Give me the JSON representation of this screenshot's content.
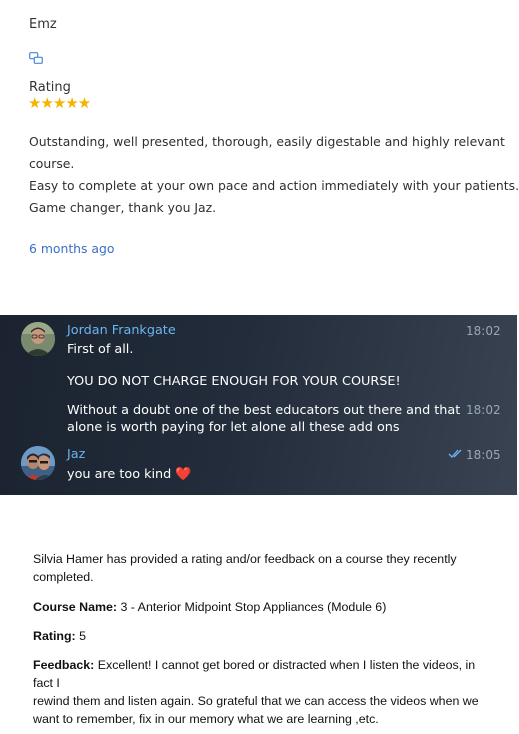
{
  "review1": {
    "reviewer": "Emz",
    "rating_label": "Rating",
    "stars": "★★★★★",
    "lines": [
      "Outstanding, well presented, thorough, easily digestable and highly relevant",
      "course.",
      "Easy to complete at your own pace and action immediately with your patients.",
      "Game changer, thank you Jaz."
    ],
    "time_ago": "6 months ago"
  },
  "chat": {
    "messages": [
      {
        "sender": "Jordan Frankgate",
        "time": "18:02",
        "text": "First of all."
      },
      {
        "text": "YOU DO NOT CHARGE ENOUGH FOR YOUR COURSE!"
      },
      {
        "line1": "Without a doubt one of the best educators out there and that",
        "line2": "alone is worth paying for let alone all these add ons",
        "time": "18:02"
      },
      {
        "sender": "Jaz",
        "time": "18:05",
        "text": "you are too kind",
        "emoji": "❤️"
      }
    ]
  },
  "review3": {
    "intro_line1": "Silvia Hamer has provided a rating and/or feedback on a course they recently",
    "intro_line2": "completed.",
    "course_label": "Course Name:",
    "course_value": "3 - Anterior Midpoint Stop Appliances (Module 6)",
    "rating_label": "Rating:",
    "rating_value": "5",
    "feedback_label": "Feedback:",
    "feedback_line1": "Excellent! I cannot get bored or distracted when I listen the videos, in fact I",
    "feedback_line2": "rewind them and listen again. So grateful that we can access the videos when we",
    "feedback_line3": "want to remember, fix in our memory what we are learning ,etc."
  }
}
